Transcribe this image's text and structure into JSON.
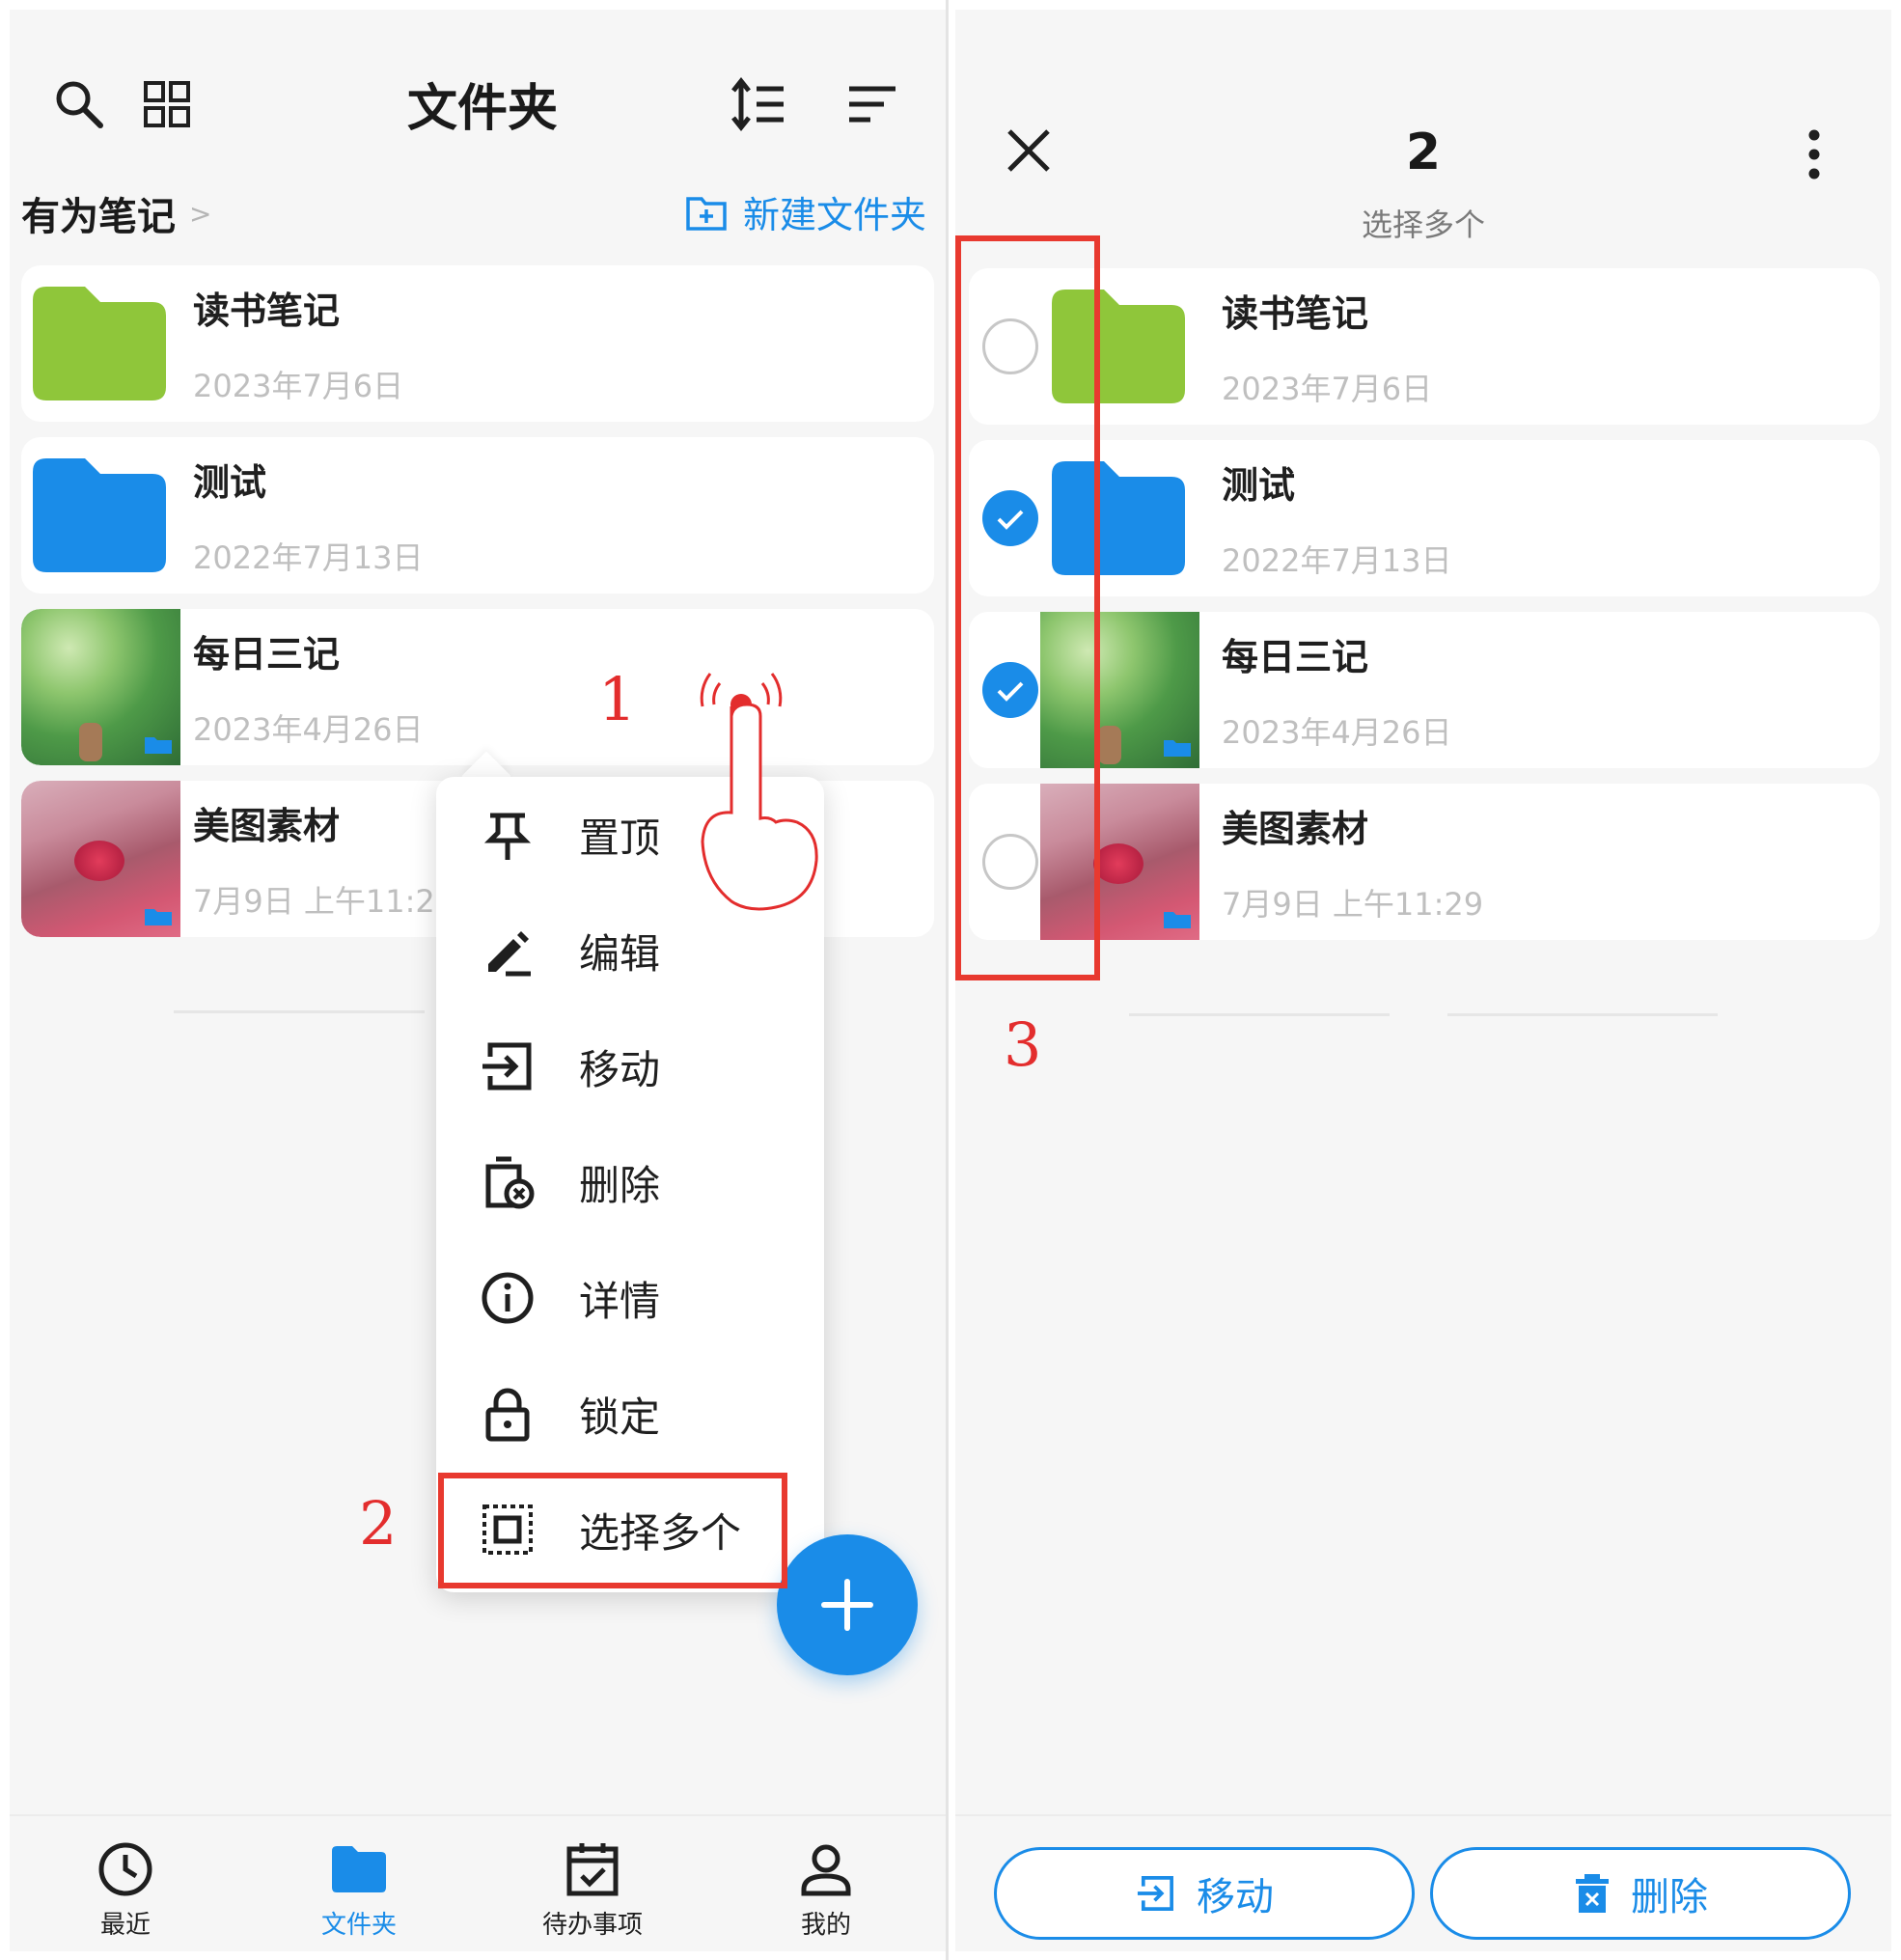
{
  "colors": {
    "accent": "#1a8ce8",
    "folder_green": "#8fc63a",
    "folder_blue": "#1a8ce8",
    "annotation_red": "#e8392f",
    "date_gray": "#bfbfbf"
  },
  "left": {
    "header": {
      "title": "文件夹",
      "icons": [
        "search-icon",
        "grid-icon",
        "sort-order-icon",
        "filter-icon"
      ]
    },
    "breadcrumb": {
      "root": "有为笔记",
      "chevron": ">"
    },
    "new_folder": {
      "label": "新建文件夹",
      "icon": "new-folder-icon"
    },
    "items": [
      {
        "name": "读书笔记",
        "date": "2023年7月6日",
        "thumb": "folder-green"
      },
      {
        "name": "测试",
        "date": "2022年7月13日",
        "thumb": "folder-blue"
      },
      {
        "name": "每日三记",
        "date": "2023年4月26日",
        "thumb": "image-green"
      },
      {
        "name": "美图素材",
        "date": "7月9日 上午11:2",
        "thumb": "image-pink"
      }
    ],
    "menu": [
      {
        "label": "置顶",
        "icon": "pin-icon"
      },
      {
        "label": "编辑",
        "icon": "edit-icon"
      },
      {
        "label": "移动",
        "icon": "move-icon"
      },
      {
        "label": "删除",
        "icon": "delete-icon"
      },
      {
        "label": "详情",
        "icon": "info-icon"
      },
      {
        "label": "锁定",
        "icon": "lock-icon"
      },
      {
        "label": "选择多个",
        "icon": "select-multiple-icon"
      }
    ],
    "fab": {
      "icon": "plus-icon"
    },
    "bottom_nav": [
      {
        "label": "最近",
        "icon": "clock-icon",
        "active": false
      },
      {
        "label": "文件夹",
        "icon": "folder-icon",
        "active": true
      },
      {
        "label": "待办事项",
        "icon": "calendar-check-icon",
        "active": false
      },
      {
        "label": "我的",
        "icon": "person-icon",
        "active": false
      }
    ]
  },
  "right": {
    "header": {
      "count": "2",
      "subtitle": "选择多个",
      "icons": [
        "close-icon",
        "more-vertical-icon"
      ]
    },
    "items": [
      {
        "name": "读书笔记",
        "date": "2023年7月6日",
        "checked": false,
        "thumb": "folder-green"
      },
      {
        "name": "测试",
        "date": "2022年7月13日",
        "checked": true,
        "thumb": "folder-blue"
      },
      {
        "name": "每日三记",
        "date": "2023年4月26日",
        "checked": true,
        "thumb": "image-green"
      },
      {
        "name": "美图素材",
        "date": "7月9日 上午11:29",
        "checked": false,
        "thumb": "image-pink"
      }
    ],
    "actions": [
      {
        "label": "移动",
        "icon": "move-icon"
      },
      {
        "label": "删除",
        "icon": "trash-icon"
      }
    ]
  },
  "annotations": {
    "step1": "1",
    "step2": "2",
    "step3": "3"
  }
}
